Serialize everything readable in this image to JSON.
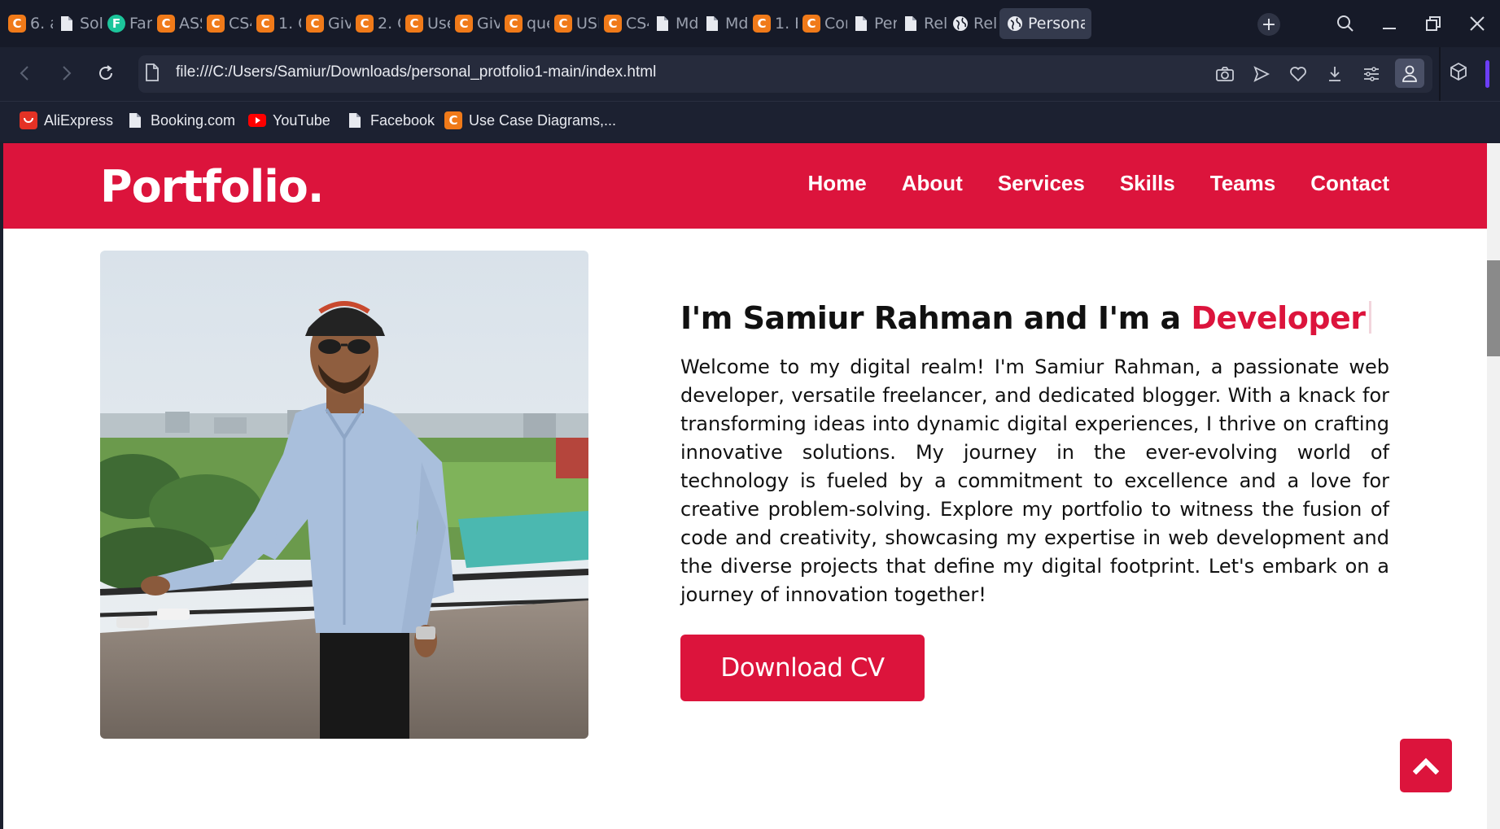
{
  "browser": {
    "tabs": [
      {
        "label": "6. a",
        "icon": "c-icon"
      },
      {
        "label": "Sol",
        "icon": "doc-icon"
      },
      {
        "label": "Fan",
        "icon": "f-icon"
      },
      {
        "label": "ASS",
        "icon": "c-icon"
      },
      {
        "label": "CS4",
        "icon": "c-icon"
      },
      {
        "label": "1. G",
        "icon": "c-icon"
      },
      {
        "label": "Giv",
        "icon": "c-icon"
      },
      {
        "label": "2. G",
        "icon": "c-icon"
      },
      {
        "label": "Use",
        "icon": "c-icon"
      },
      {
        "label": "Giv",
        "icon": "c-icon"
      },
      {
        "label": "que",
        "icon": "c-icon"
      },
      {
        "label": "USE",
        "icon": "c-icon"
      },
      {
        "label": "CS4",
        "icon": "c-icon"
      },
      {
        "label": "Md",
        "icon": "doc-icon"
      },
      {
        "label": "Md",
        "icon": "doc-icon"
      },
      {
        "label": "1. F",
        "icon": "c-icon"
      },
      {
        "label": "Cor",
        "icon": "c-icon"
      },
      {
        "label": "Per",
        "icon": "doc-icon"
      },
      {
        "label": "Rel",
        "icon": "doc-icon"
      },
      {
        "label": "Rel",
        "icon": "globe-icon"
      },
      {
        "label": "Persona",
        "icon": "globe-icon",
        "active": true
      }
    ],
    "url": "file:///C:/Users/Samiur/Downloads/personal_protfolio1-main/index.html",
    "bookmarks": [
      {
        "label": "AliExpress",
        "icon": "aliexpress-icon"
      },
      {
        "label": "Booking.com",
        "icon": "doc-icon"
      },
      {
        "label": "YouTube",
        "icon": "youtube-icon"
      },
      {
        "label": "Facebook",
        "icon": "doc-icon"
      },
      {
        "label": "Use Case Diagrams,...",
        "icon": "c-icon"
      }
    ],
    "colors": {
      "tab_c_icon": "#f07a19",
      "accent_purple": "#6c3ef5"
    }
  },
  "site": {
    "logo": "Portfolio.",
    "nav": [
      "Home",
      "About",
      "Services",
      "Skills",
      "Teams",
      "Contact"
    ],
    "headline_prefix": "I'm Samiur Rahman and I'm a ",
    "headline_accent": "Developer",
    "bio": "Welcome to my digital realm! I'm Samiur Rahman, a passionate web developer, versatile freelancer, and dedicated blogger. With a knack for transforming ideas into dynamic digital experiences, I thrive on crafting innovative solutions. My journey in the ever-evolving world of technology is fueled by a commitment to excellence and a love for creative problem-solving. Explore my portfolio to witness the fusion of code and creativity, showcasing my expertise in web development and the diverse projects that define my digital footprint. Let's embark on a journey of innovation together!",
    "cv_button": "Download CV",
    "colors": {
      "brand": "#dc143c"
    }
  }
}
